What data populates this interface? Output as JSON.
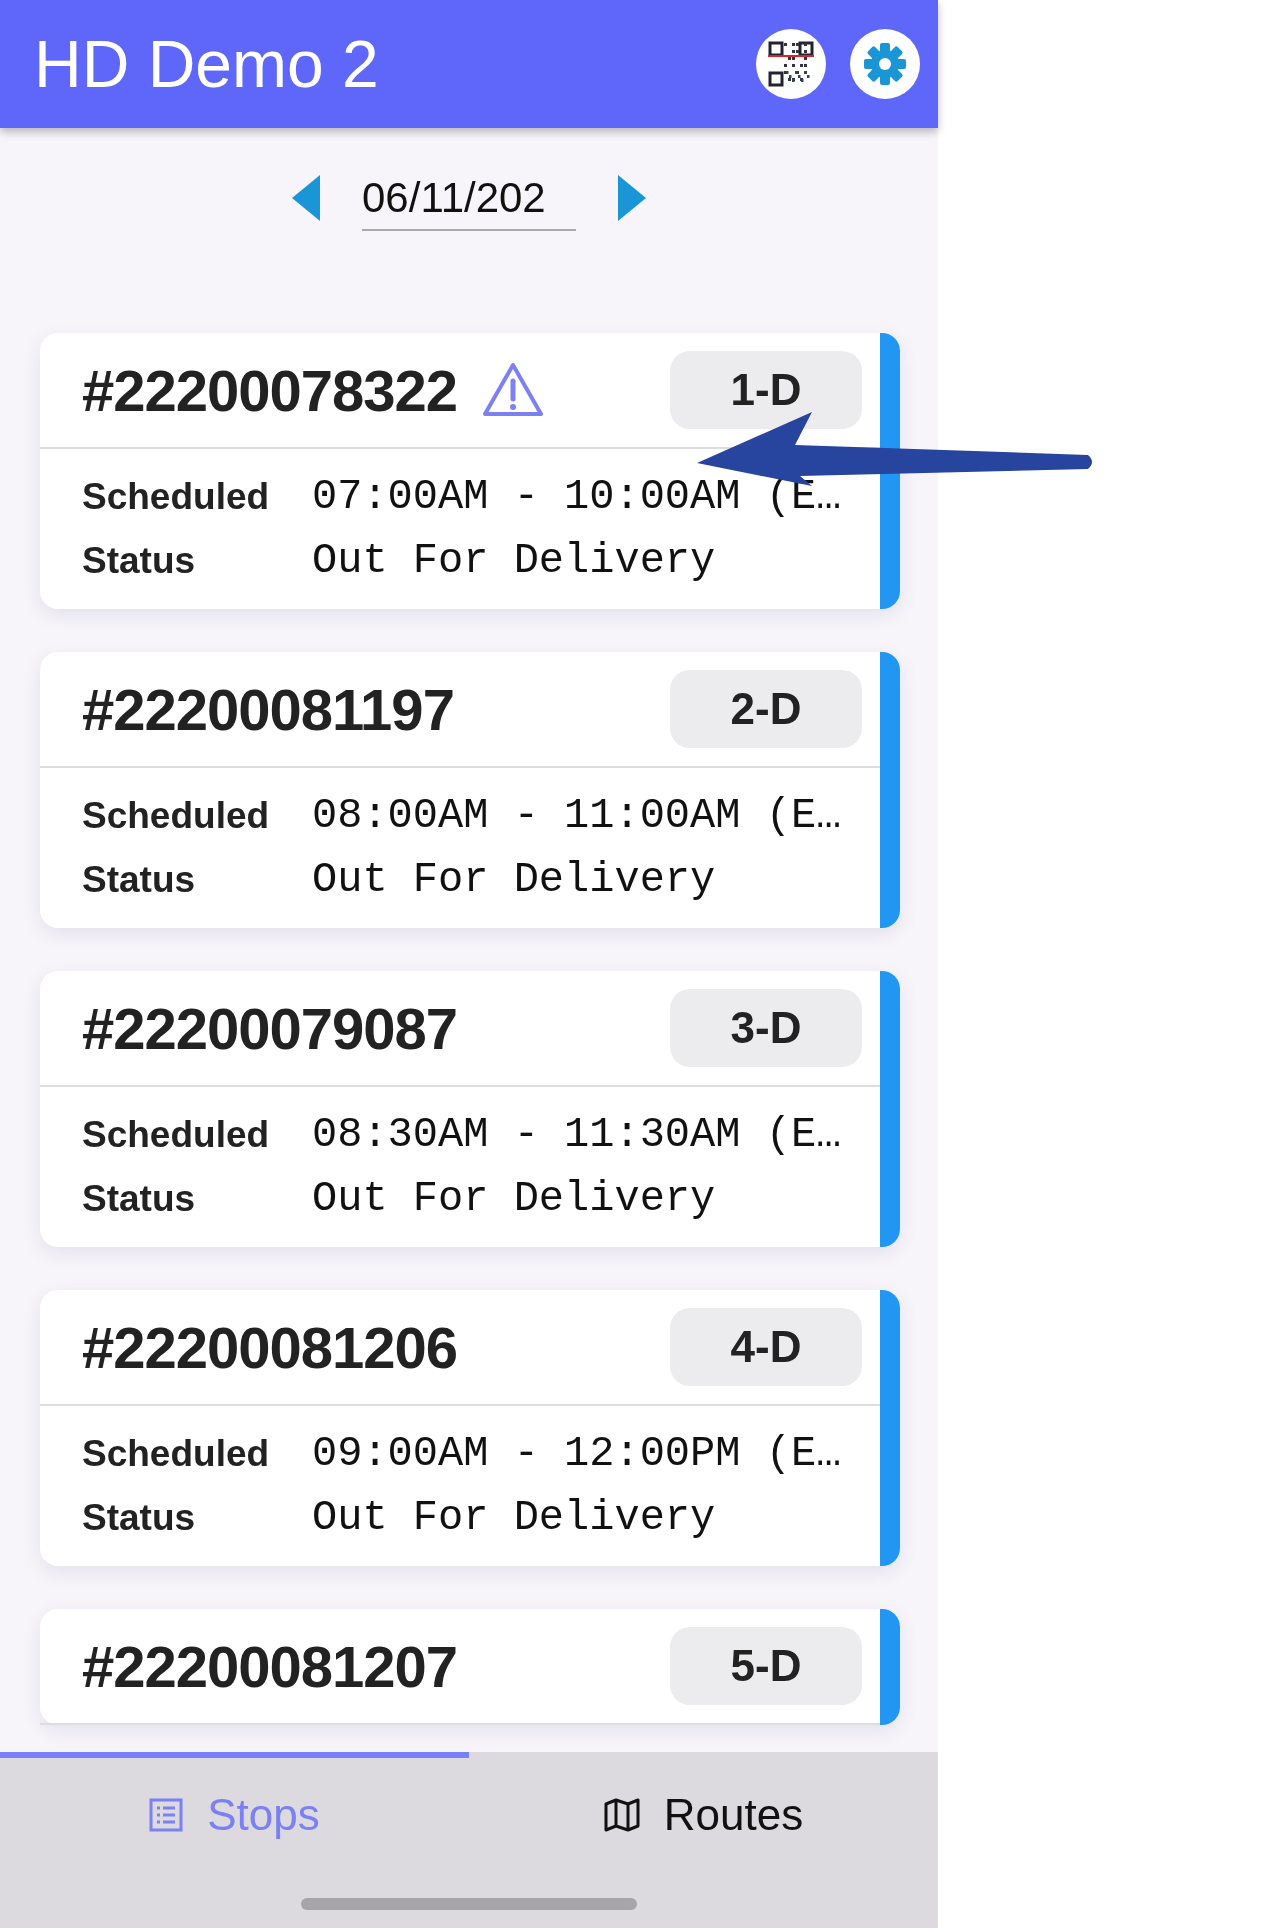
{
  "header": {
    "title": "HD Demo 2"
  },
  "date_field": {
    "value": "06/11/202"
  },
  "stops": [
    {
      "order": "#22200078322",
      "warning": true,
      "badge": "1-D",
      "rows": [
        {
          "label": "Scheduled",
          "value": "07:00AM - 10:00AM (E…"
        },
        {
          "label": "Status",
          "value": "Out For Delivery"
        }
      ]
    },
    {
      "order": "#22200081197",
      "warning": false,
      "badge": "2-D",
      "rows": [
        {
          "label": "Scheduled",
          "value": "08:00AM - 11:00AM (E…"
        },
        {
          "label": "Status",
          "value": "Out For Delivery"
        }
      ]
    },
    {
      "order": "#22200079087",
      "warning": false,
      "badge": "3-D",
      "rows": [
        {
          "label": "Scheduled",
          "value": "08:30AM - 11:30AM (E…"
        },
        {
          "label": "Status",
          "value": "Out For Delivery"
        }
      ]
    },
    {
      "order": "#22200081206",
      "warning": false,
      "badge": "4-D",
      "rows": [
        {
          "label": "Scheduled",
          "value": "09:00AM - 12:00PM (E…"
        },
        {
          "label": "Status",
          "value": "Out For Delivery"
        }
      ]
    },
    {
      "order": "#22200081207",
      "warning": false,
      "badge": "5-D"
    }
  ],
  "tabs": [
    {
      "label": "Stops",
      "kind": "list",
      "selected": true
    },
    {
      "label": "Routes",
      "kind": "map",
      "selected": false
    }
  ]
}
